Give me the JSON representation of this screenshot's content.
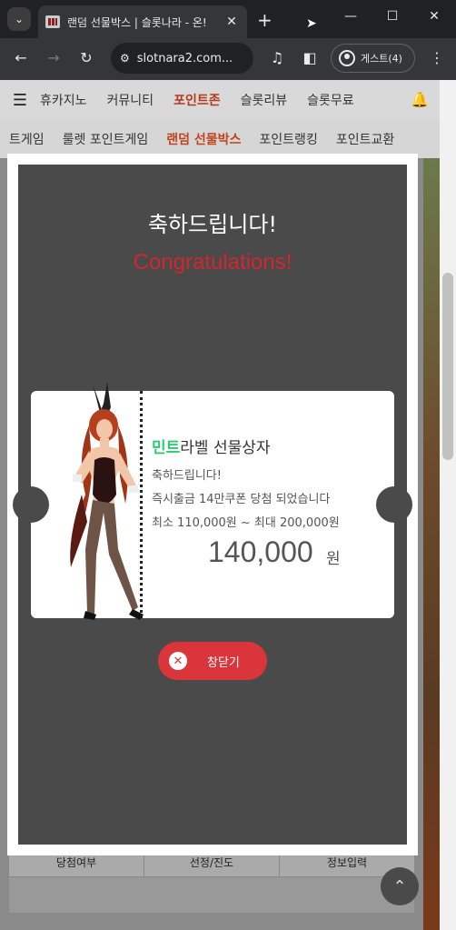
{
  "browser": {
    "tab_title": "랜덤 선물박스 | 슬롯나라 - 온!",
    "tab_close": "✕",
    "new_tab": "+",
    "address": "slotnara2.com...",
    "profile_label": "게스트(4)",
    "icons": [
      "tab-search-icon",
      "close-icon",
      "plus-icon",
      "minimize-icon",
      "maximize-icon",
      "close-window-icon",
      "back-icon",
      "forward-icon",
      "reload-icon",
      "site-info-icon",
      "media-icon",
      "side-panel-icon",
      "profile-icon",
      "more-icon"
    ]
  },
  "nav_main": {
    "items": [
      "휴카지노",
      "커뮤니티",
      "포인트존",
      "슬롯리뷰",
      "슬롯무료"
    ],
    "active_index": 2
  },
  "nav_sub": {
    "items": [
      "트게임",
      "룰렛 포인트게임",
      "랜덤 선물박스",
      "포인트랭킹",
      "포인트교환"
    ],
    "active_index": 2
  },
  "table": {
    "headers": [
      "당첨여부",
      "선정/진도",
      "정보입력"
    ]
  },
  "modal": {
    "heading": "축하드립니다!",
    "heading_en": "Congratulations!",
    "card": {
      "label_highlight": "민트",
      "label_rest": "라벨 선물상자",
      "line1": "축하드립니다!",
      "line2": "즉시출금 14만쿠폰 당첨 되었습니다",
      "line3": "최소 110,000원 ~ 최대 200,000원",
      "amount": "140,000",
      "amount_unit": "원"
    },
    "close_label": "창닫기"
  },
  "colors": {
    "accent_red": "#d0272e",
    "mint": "#2ecc71",
    "modal_bg": "#4a4a4a"
  }
}
